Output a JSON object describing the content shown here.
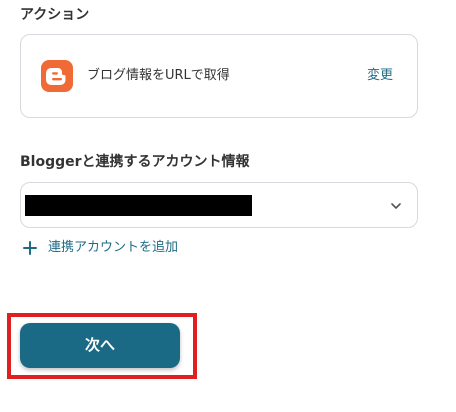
{
  "action_section": {
    "label": "アクション",
    "action_name": "ブログ情報をURLで取得",
    "change_label": "変更",
    "app_icon": "blogger-icon"
  },
  "account_section": {
    "label": "Bloggerと連携するアカウント情報",
    "selected_value": "████████████",
    "chevron_icon": "chevron-down-icon",
    "add_account_label": "連携アカウントを追加",
    "add_icon": "plus-icon"
  },
  "footer": {
    "next_label": "次へ"
  },
  "colors": {
    "accent": "#1b6a85",
    "link": "#1f6b86",
    "blogger_orange": "#f06a35",
    "highlight": "#e02020",
    "border": "#d6d9dd"
  }
}
